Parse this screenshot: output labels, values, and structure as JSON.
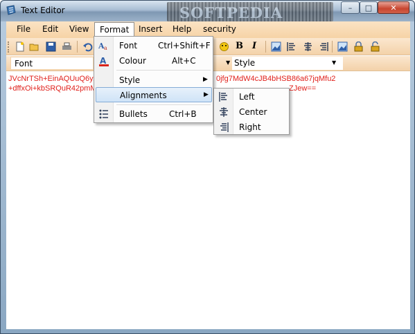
{
  "window": {
    "title": "Text Editor",
    "watermark": "SOFTPEDIA",
    "minimize": "–",
    "maximize": "□",
    "close": "✕"
  },
  "menubar": {
    "items": [
      "File",
      "Edit",
      "View",
      "Format",
      "Insert",
      "Help",
      "security"
    ],
    "active": "Format"
  },
  "toolbar": {
    "icons": [
      "new-file-icon",
      "open-folder-icon",
      "save-icon",
      "print-icon",
      "undo-icon",
      "emoji-icon",
      "bold-icon",
      "italic-icon",
      "image-icon",
      "align-left-icon",
      "align-center-icon",
      "align-right-icon",
      "picture-icon",
      "lock-icon",
      "unlock-icon"
    ],
    "bold_label": "B",
    "italic_label": "I"
  },
  "fontbar": {
    "font_label": "Font",
    "style_label": "Style"
  },
  "editor": {
    "line1_left": "JVcNrTSh+EinAQUuQ6yA",
    "line1_right": "0jfg7MdW4cJB4bHSB86a67jqMfu2",
    "line2_left": "+dffxOi+kbSRQuR42pmM",
    "line2_right": "ZJew==",
    "text_color": "#e0201b"
  },
  "format_menu": {
    "items": [
      {
        "label": "Font",
        "shortcut": "Ctrl+Shift+F",
        "icon": "font-icon"
      },
      {
        "label": "Colour",
        "shortcut": "Alt+C",
        "icon": "colour-icon"
      },
      {
        "label": "Style",
        "shortcut": "",
        "icon": "",
        "submenu": true
      },
      {
        "label": "Alignments",
        "shortcut": "",
        "icon": "",
        "submenu": true,
        "highlighted": true
      },
      {
        "label": "Bullets",
        "shortcut": "Ctrl+B",
        "icon": "bullets-icon"
      }
    ]
  },
  "alignments_submenu": {
    "items": [
      {
        "label": "Left",
        "icon": "align-left-icon"
      },
      {
        "label": "Center",
        "icon": "align-center-icon"
      },
      {
        "label": "Right",
        "icon": "align-right-icon"
      }
    ]
  },
  "colors": {
    "menubar": "#f6d3a6",
    "highlight": "#cfe3f7",
    "editor_text": "#e0201b"
  }
}
